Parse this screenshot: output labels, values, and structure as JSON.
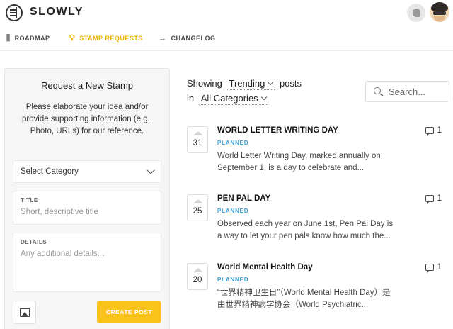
{
  "app": {
    "brand": "SLOWLY"
  },
  "nav": {
    "items": [
      {
        "label": "ROADMAP",
        "icon": "roadmap-icon"
      },
      {
        "label": "STAMP REQUESTS",
        "icon": "lightbulb-icon",
        "active": true
      },
      {
        "label": "CHANGELOG",
        "icon": "arrow-right-icon"
      }
    ]
  },
  "form": {
    "title": "Request a New Stamp",
    "description": "Please elaborate your idea and/or provide supporting information (e.g., Photo, URLs) for our reference.",
    "category_placeholder": "Select Category",
    "title_label": "TITLE",
    "title_placeholder": "Short, descriptive title",
    "details_label": "DETAILS",
    "details_placeholder": "Any additional details...",
    "submit_label": "CREATE POST"
  },
  "filter": {
    "showing": "Showing",
    "sort": "Trending",
    "posts": "posts",
    "in": "in",
    "category": "All Categories",
    "search_placeholder": "Search..."
  },
  "posts": [
    {
      "votes": "31",
      "title": "WORLD LETTER WRITING DAY",
      "status": "PLANNED",
      "excerpt_1": "World Letter Writing Day, marked annually on",
      "excerpt_2": "September 1, is a day to celebrate and...",
      "comments": "1"
    },
    {
      "votes": "25",
      "title": "PEN PAL DAY",
      "status": "PLANNED",
      "excerpt_1": "Observed each year on June 1st, Pen Pal Day is",
      "excerpt_2": "a way to let your pen pals know how much the...",
      "comments": "1"
    },
    {
      "votes": "20",
      "title": "World Mental Health Day",
      "status": "PLANNED",
      "excerpt_1": "“世界精神卫生日”（World Mental Health Day）是",
      "excerpt_2": "由世界精神病学协会（World Psychiatric...",
      "comments": "1"
    }
  ],
  "colors": {
    "accent": "#f9c31b",
    "nav_active": "#e9b100",
    "status": "#3a9fd6"
  }
}
